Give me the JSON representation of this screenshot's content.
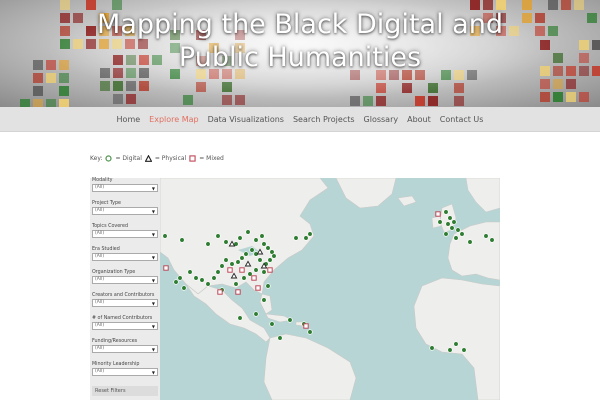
{
  "banner": {
    "title_line1": "Mapping the Black Digital and",
    "title_line2": "Public Humanities"
  },
  "nav": {
    "items": [
      {
        "label": "Home"
      },
      {
        "label": "Explore Map"
      },
      {
        "label": "Data Visualizations"
      },
      {
        "label": "Search Projects"
      },
      {
        "label": "Glossary"
      },
      {
        "label": "About"
      },
      {
        "label": "Contact Us"
      }
    ],
    "active": "Explore Map",
    "active_color": "#e07060"
  },
  "key": {
    "prefix": "Key:",
    "digital": "= Digital",
    "physical": "= Physical",
    "mixed": "= Mixed",
    "digital_color": "#3c8a3c",
    "physical_color": "#222222",
    "mixed_color": "#c04a5a"
  },
  "filters": {
    "items": [
      {
        "label": "Modality",
        "value": "(All)"
      },
      {
        "label": "Project Type",
        "value": "(All)"
      },
      {
        "label": "Topics Covered",
        "value": "(All)"
      },
      {
        "label": "Era Studied",
        "value": "(All)"
      },
      {
        "label": "Organization Type",
        "value": "(All)"
      },
      {
        "label": "Creators and Contributors",
        "value": "(All)"
      },
      {
        "label": "# of Named Contributors",
        "value": "(All)"
      },
      {
        "label": "Funding/Resources",
        "value": "(All)"
      },
      {
        "label": "Minority Leadership",
        "value": "(All)"
      }
    ],
    "reset_label": "Reset Filters"
  },
  "map": {
    "land_color": "#eeeeec",
    "water_color": "#b8d5d5",
    "marker_color": "#2f7d32"
  }
}
